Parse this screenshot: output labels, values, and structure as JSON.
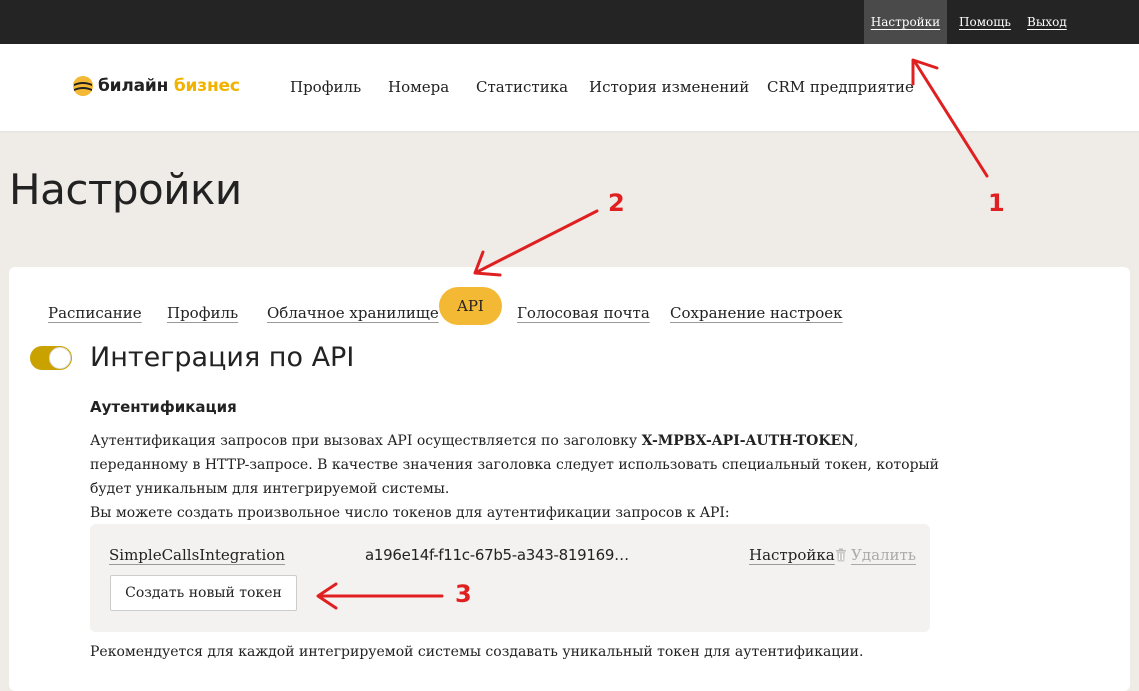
{
  "topbar": {
    "settings": "Настройки",
    "help": "Помощь",
    "logout": "Выход"
  },
  "logo": {
    "brand": "билайн",
    "suffix": "бизнес",
    "icon": "beeline-logo-icon"
  },
  "nav": {
    "items": [
      {
        "label": "Профиль"
      },
      {
        "label": "Номера"
      },
      {
        "label": "Статистика"
      },
      {
        "label": "История изменений"
      },
      {
        "label": "CRM предприятие"
      }
    ]
  },
  "page": {
    "title": "Настройки"
  },
  "tabs": [
    {
      "label": "Расписание"
    },
    {
      "label": "Профиль"
    },
    {
      "label": "Облачное хранилище"
    },
    {
      "label": "API",
      "active": true
    },
    {
      "label": "Голосовая почта"
    },
    {
      "label": "Сохранение настроек"
    }
  ],
  "api": {
    "enabled": true,
    "title": "Интеграция по API",
    "auth_heading": "Аутентификация",
    "desc_part1": "Аутентификация запросов при вызовах API осуществляется по заголовку ",
    "desc_header": "X-MPBX-API-AUTH-TOKEN",
    "desc_part2": ", переданному в HTTP-запросе. В качестве значения заголовка следует использовать специальный токен, который будет уникальным для интегрируемой системы.",
    "desc_line2": "Вы можете создать произвольное число токенов для аутентификации запросов к API:",
    "token": {
      "name": "SimpleCallsIntegration",
      "value": "a196e14f-f11c-67b5-a343-819169…",
      "setup_label": "Настройка",
      "delete_label": "Удалить"
    },
    "create_button": "Создать новый токен",
    "recommendation": "Рекомендуется для каждой интегрируемой системы создавать уникальный токен для аутентификации."
  },
  "annotations": {
    "step1": "1",
    "step2": "2",
    "step3": "3",
    "color": "#e02020"
  },
  "colors": {
    "accent": "#f4b934",
    "topbar": "#242424",
    "toggle": "#c9a200"
  }
}
